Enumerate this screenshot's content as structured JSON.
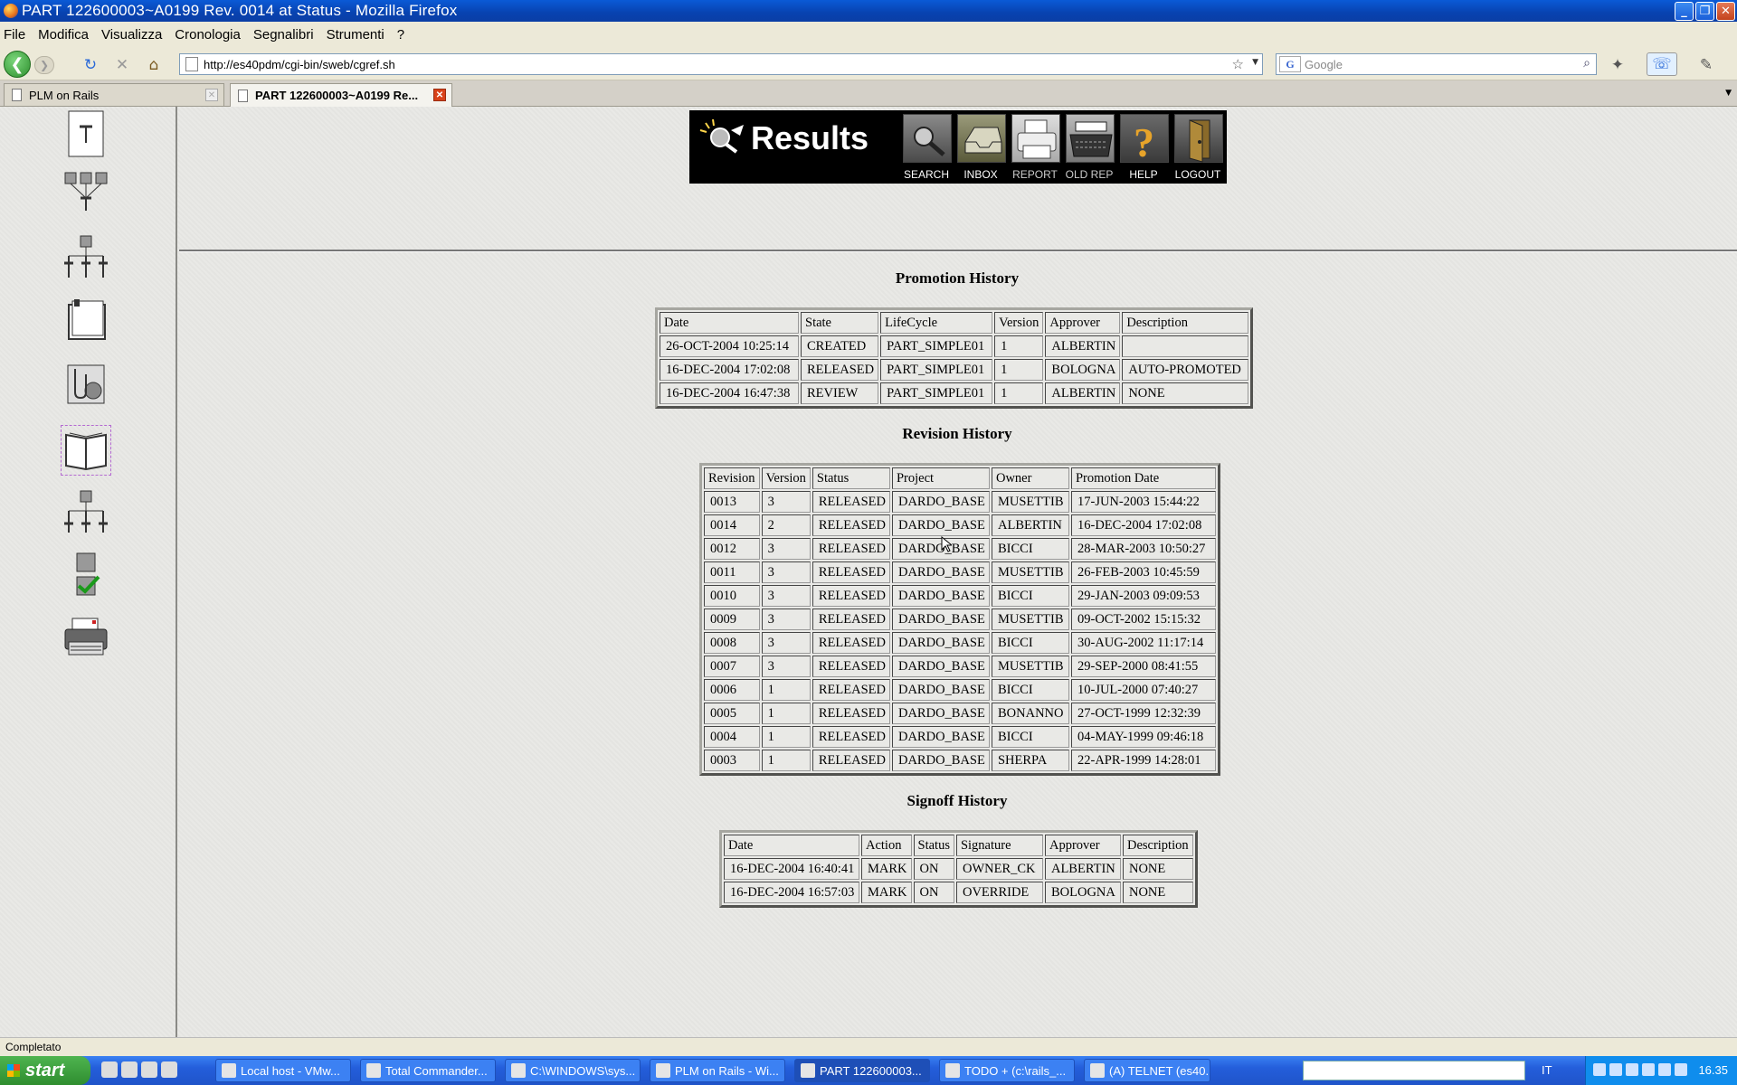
{
  "window": {
    "title": "PART 122600003~A0199 Rev. 0014 at Status  - Mozilla Firefox"
  },
  "menu": [
    "File",
    "Modifica",
    "Visualizza",
    "Cronologia",
    "Segnalibri",
    "Strumenti",
    "?"
  ],
  "nav": {
    "url": "http://es40pdm/cgi-bin/sweb/cgref.sh",
    "search_placeholder": "Google"
  },
  "tabs": [
    {
      "label": "PLM on Rails",
      "active": false
    },
    {
      "label": "PART 122600003~A0199 Re...",
      "active": true
    }
  ],
  "banner": {
    "title": "Results",
    "buttons": [
      "SEARCH",
      "INBOX",
      "REPORT",
      "OLD REP",
      "HELP",
      "LOGOUT"
    ]
  },
  "promotion": {
    "title": "Promotion History",
    "headers": [
      "Date",
      "State",
      "LifeCycle",
      "Version",
      "Approver",
      "Description"
    ],
    "rows": [
      [
        "26-OCT-2004 10:25:14",
        "CREATED",
        "PART_SIMPLE01",
        "1",
        "ALBERTIN",
        ""
      ],
      [
        "16-DEC-2004 17:02:08",
        "RELEASED",
        "PART_SIMPLE01",
        "1",
        "BOLOGNA",
        "AUTO-PROMOTED"
      ],
      [
        "16-DEC-2004 16:47:38",
        "REVIEW",
        "PART_SIMPLE01",
        "1",
        "ALBERTIN",
        "NONE"
      ]
    ]
  },
  "revision": {
    "title": "Revision History",
    "headers": [
      "Revision",
      "Version",
      "Status",
      "Project",
      "Owner",
      "Promotion Date"
    ],
    "rows": [
      [
        "0013",
        "3",
        "RELEASED",
        "DARDO_BASE",
        "MUSETTIB",
        "17-JUN-2003 15:44:22"
      ],
      [
        "0014",
        "2",
        "RELEASED",
        "DARDO_BASE",
        "ALBERTIN",
        "16-DEC-2004 17:02:08"
      ],
      [
        "0012",
        "3",
        "RELEASED",
        "DARDO_BASE",
        "BICCI",
        "28-MAR-2003 10:50:27"
      ],
      [
        "0011",
        "3",
        "RELEASED",
        "DARDO_BASE",
        "MUSETTIB",
        "26-FEB-2003 10:45:59"
      ],
      [
        "0010",
        "3",
        "RELEASED",
        "DARDO_BASE",
        "BICCI",
        "29-JAN-2003 09:09:53"
      ],
      [
        "0009",
        "3",
        "RELEASED",
        "DARDO_BASE",
        "MUSETTIB",
        "09-OCT-2002 15:15:32"
      ],
      [
        "0008",
        "3",
        "RELEASED",
        "DARDO_BASE",
        "BICCI",
        "30-AUG-2002 11:17:14"
      ],
      [
        "0007",
        "3",
        "RELEASED",
        "DARDO_BASE",
        "MUSETTIB",
        "29-SEP-2000 08:41:55"
      ],
      [
        "0006",
        "1",
        "RELEASED",
        "DARDO_BASE",
        "BICCI",
        "10-JUL-2000 07:40:27"
      ],
      [
        "0005",
        "1",
        "RELEASED",
        "DARDO_BASE",
        "BONANNO",
        "27-OCT-1999 12:32:39"
      ],
      [
        "0004",
        "1",
        "RELEASED",
        "DARDO_BASE",
        "BICCI",
        "04-MAY-1999 09:46:18"
      ],
      [
        "0003",
        "1",
        "RELEASED",
        "DARDO_BASE",
        "SHERPA",
        "22-APR-1999 14:28:01"
      ]
    ]
  },
  "signoff": {
    "title": "Signoff History",
    "headers": [
      "Date",
      "Action",
      "Status",
      "Signature",
      "Approver",
      "Description"
    ],
    "rows": [
      [
        "16-DEC-2004 16:40:41",
        "MARK",
        "ON",
        "OWNER_CK",
        "ALBERTIN",
        "NONE"
      ],
      [
        "16-DEC-2004 16:57:03",
        "MARK",
        "ON",
        "OVERRIDE",
        "BOLOGNA",
        "NONE"
      ]
    ]
  },
  "sidebar_icons": [
    "document-pin-icon",
    "multi-level-tree-icon",
    "single-level-tree-icon",
    "clipboard-icon",
    "attachment-icon",
    "open-book-icon",
    "where-used-tree-icon",
    "checklist-icon",
    "printer-icon"
  ],
  "status": "Completato",
  "taskbar": {
    "start": "start",
    "items": [
      "Local host - VMw...",
      "Total Commander...",
      "C:\\WINDOWS\\sys...",
      "PLM on Rails - Wi...",
      "PART 122600003...",
      "TODO + (c:\\rails_...",
      "(A) TELNET (es40..."
    ],
    "lang": "IT",
    "clock": "16.35"
  },
  "colors": {
    "titlebar": "#0842b0",
    "banner_bg": "#000000",
    "page_bg": "#e9e9e6"
  }
}
